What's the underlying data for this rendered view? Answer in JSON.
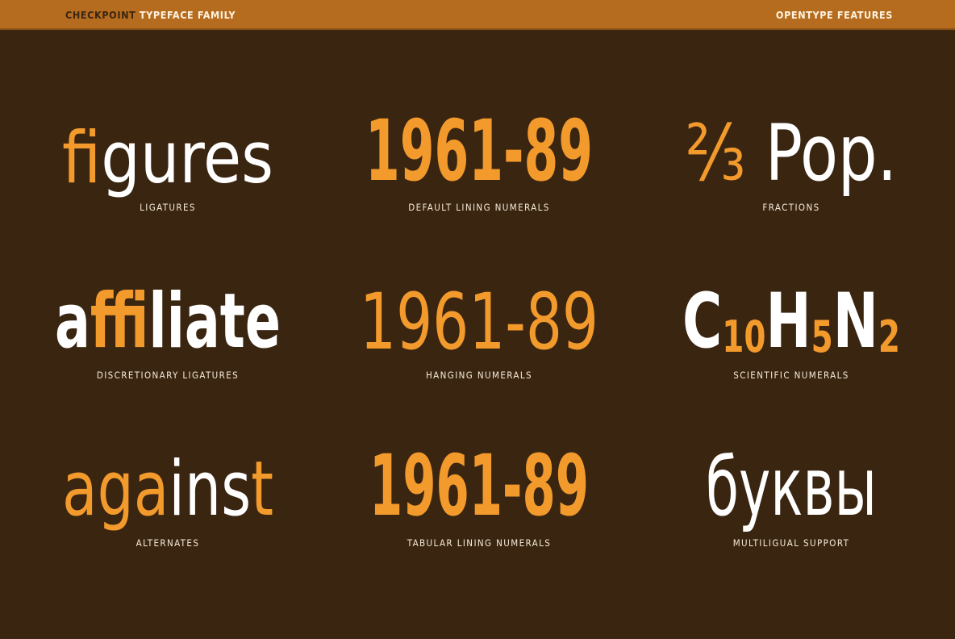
{
  "header": {
    "brand_strong": "CHECKPOINT",
    "brand_rest": " TYPEFACE FAMILY",
    "right": "OPENTYPE FEATURES"
  },
  "colors": {
    "background": "#3a2511",
    "bar": "#b66c1f",
    "accent": "#f39a2c",
    "text": "#ffffff"
  },
  "samples": {
    "ligatures": {
      "parts": [
        {
          "text": "fi",
          "color": "#f39a2c"
        },
        {
          "text": "gures",
          "color": "#ffffff"
        }
      ],
      "caption": "LIGATURES"
    },
    "default_lining": {
      "parts": [
        {
          "text": "1961-89",
          "color": "#f39a2c"
        }
      ],
      "caption": "DEFAULT LINING NUMERALS"
    },
    "fractions": {
      "parts": [
        {
          "text": "⅔",
          "color": "#f39a2c"
        },
        {
          "text": " Pop.",
          "color": "#ffffff"
        }
      ],
      "caption": "FRACTIONS"
    },
    "discretionary": {
      "parts": [
        {
          "text": "a",
          "color": "#ffffff"
        },
        {
          "text": "ffi",
          "color": "#f39a2c"
        },
        {
          "text": "liate",
          "color": "#ffffff"
        }
      ],
      "caption": "DISCRETIONARY LIGATURES"
    },
    "hanging": {
      "parts": [
        {
          "text": "1961-89",
          "color": "#f39a2c"
        }
      ],
      "caption": "HANGING NUMERALS"
    },
    "scientific": {
      "parts": [
        {
          "text": "C",
          "color": "#ffffff"
        },
        {
          "text": "10",
          "color": "#f39a2c",
          "sub": true
        },
        {
          "text": "H",
          "color": "#ffffff"
        },
        {
          "text": "5",
          "color": "#f39a2c",
          "sub": true
        },
        {
          "text": "N",
          "color": "#ffffff"
        },
        {
          "text": "2",
          "color": "#f39a2c",
          "sub": true
        }
      ],
      "caption": "SCIENTIFIC NUMERALS"
    },
    "alternates": {
      "parts": [
        {
          "text": "aga",
          "color": "#f39a2c"
        },
        {
          "text": "ins",
          "color": "#ffffff"
        },
        {
          "text": "t",
          "color": "#f39a2c"
        }
      ],
      "caption": "ALTERNATES"
    },
    "tabular": {
      "parts": [
        {
          "text": "1961-89",
          "color": "#f39a2c"
        }
      ],
      "caption": "TABULAR LINING NUMERALS"
    },
    "multilingual": {
      "parts": [
        {
          "text": "буквы",
          "color": "#ffffff"
        }
      ],
      "caption": "MULTILIGUAL SUPPORT"
    }
  }
}
